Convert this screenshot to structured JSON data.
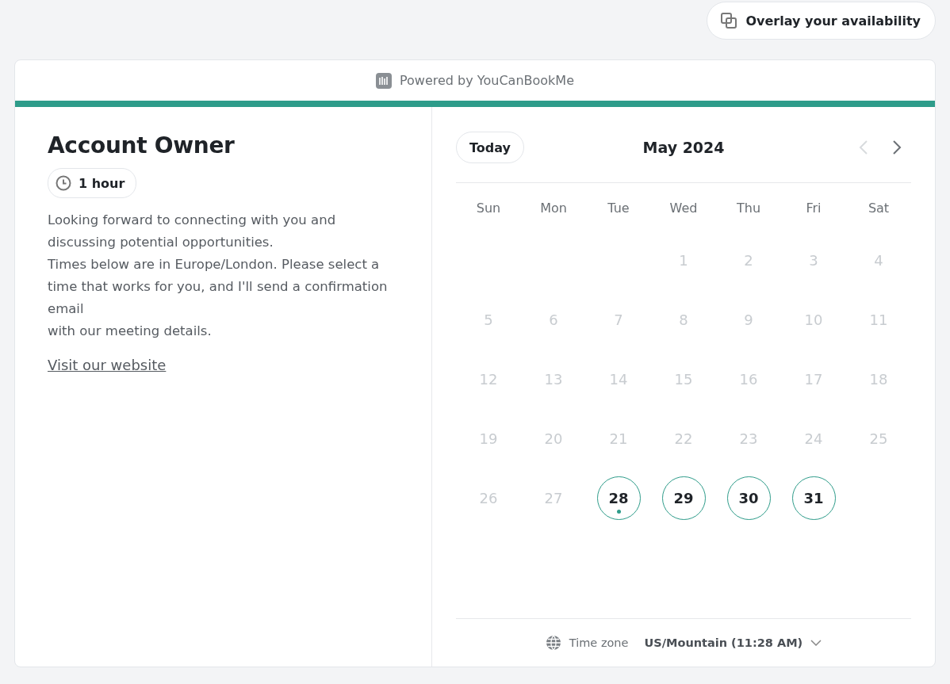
{
  "overlay_button": {
    "label": "Overlay your availability"
  },
  "powered_by": "Powered by YouCanBookMe",
  "profile": {
    "title": "Account Owner",
    "duration": "1 hour",
    "description": [
      "Looking forward to connecting with you and discussing potential opportunities.",
      "Times below are in Europe/London. Please select a time that works for you, and I'll send a confirmation email",
      "with our meeting details."
    ],
    "link": "Visit our website"
  },
  "calendar": {
    "today_button": "Today",
    "month": "May 2024",
    "prev_disabled": true,
    "next_disabled": false,
    "weekdays": [
      "Sun",
      "Mon",
      "Tue",
      "Wed",
      "Thu",
      "Fri",
      "Sat"
    ],
    "days": [
      {
        "kind": "blank"
      },
      {
        "kind": "blank"
      },
      {
        "kind": "blank"
      },
      {
        "kind": "day",
        "label": "1",
        "available": false,
        "today": false
      },
      {
        "kind": "day",
        "label": "2",
        "available": false,
        "today": false
      },
      {
        "kind": "day",
        "label": "3",
        "available": false,
        "today": false
      },
      {
        "kind": "day",
        "label": "4",
        "available": false,
        "today": false
      },
      {
        "kind": "day",
        "label": "5",
        "available": false,
        "today": false
      },
      {
        "kind": "day",
        "label": "6",
        "available": false,
        "today": false
      },
      {
        "kind": "day",
        "label": "7",
        "available": false,
        "today": false
      },
      {
        "kind": "day",
        "label": "8",
        "available": false,
        "today": false
      },
      {
        "kind": "day",
        "label": "9",
        "available": false,
        "today": false
      },
      {
        "kind": "day",
        "label": "10",
        "available": false,
        "today": false
      },
      {
        "kind": "day",
        "label": "11",
        "available": false,
        "today": false
      },
      {
        "kind": "day",
        "label": "12",
        "available": false,
        "today": false
      },
      {
        "kind": "day",
        "label": "13",
        "available": false,
        "today": false
      },
      {
        "kind": "day",
        "label": "14",
        "available": false,
        "today": false
      },
      {
        "kind": "day",
        "label": "15",
        "available": false,
        "today": false
      },
      {
        "kind": "day",
        "label": "16",
        "available": false,
        "today": false
      },
      {
        "kind": "day",
        "label": "17",
        "available": false,
        "today": false
      },
      {
        "kind": "day",
        "label": "18",
        "available": false,
        "today": false
      },
      {
        "kind": "day",
        "label": "19",
        "available": false,
        "today": false
      },
      {
        "kind": "day",
        "label": "20",
        "available": false,
        "today": false
      },
      {
        "kind": "day",
        "label": "21",
        "available": false,
        "today": false
      },
      {
        "kind": "day",
        "label": "22",
        "available": false,
        "today": false
      },
      {
        "kind": "day",
        "label": "23",
        "available": false,
        "today": false
      },
      {
        "kind": "day",
        "label": "24",
        "available": false,
        "today": false
      },
      {
        "kind": "day",
        "label": "25",
        "available": false,
        "today": false
      },
      {
        "kind": "day",
        "label": "26",
        "available": false,
        "today": false
      },
      {
        "kind": "day",
        "label": "27",
        "available": false,
        "today": false
      },
      {
        "kind": "day",
        "label": "28",
        "available": true,
        "today": true
      },
      {
        "kind": "day",
        "label": "29",
        "available": true,
        "today": false
      },
      {
        "kind": "day",
        "label": "30",
        "available": true,
        "today": false
      },
      {
        "kind": "day",
        "label": "31",
        "available": true,
        "today": false
      }
    ]
  },
  "timezone": {
    "label": "Time zone",
    "value": "US/Mountain (11:28 AM)"
  }
}
